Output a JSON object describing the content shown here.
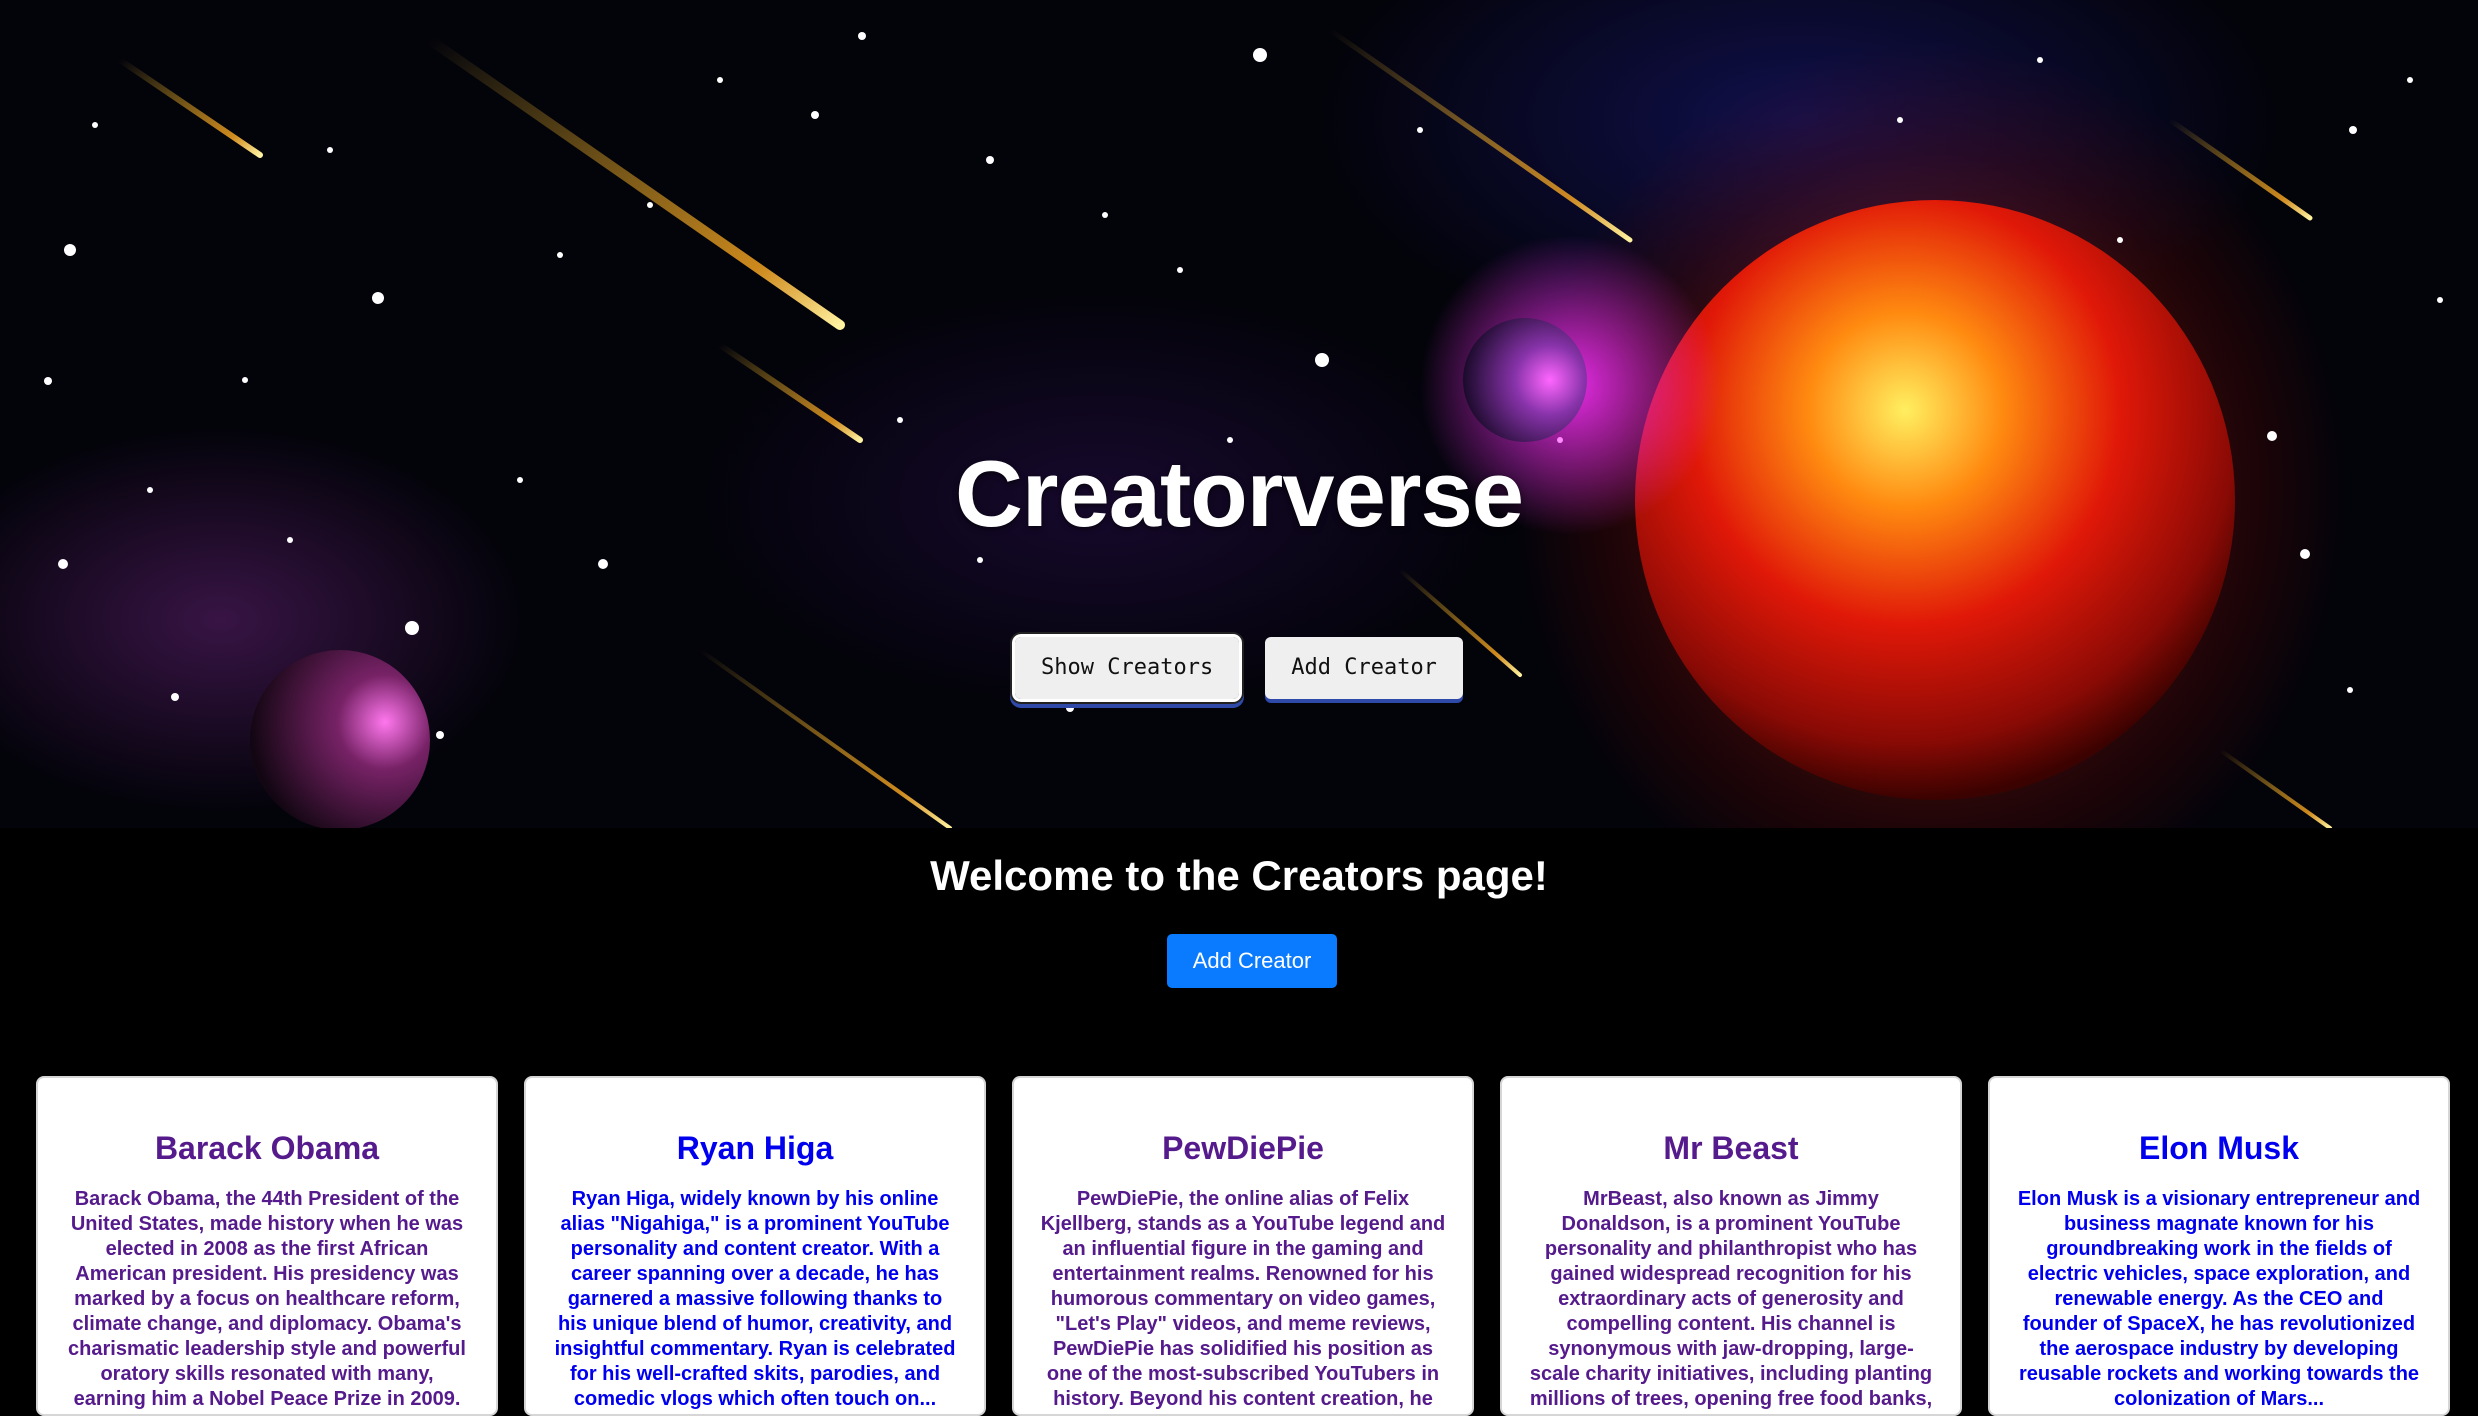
{
  "hero": {
    "title": "Creatorverse",
    "buttons": [
      {
        "label": "Show Creators"
      },
      {
        "label": "Add Creator"
      }
    ]
  },
  "main": {
    "welcome": "Welcome to the Creators page!",
    "add_button": "Add Creator"
  },
  "creators": [
    {
      "name": "Barack Obama",
      "link_color": "#551a8b",
      "description": "Barack Obama, the 44th President of the United States, made history when he was elected in 2008 as the first African American president. His presidency was marked by a focus on healthcare reform, climate change, and diplomacy. Obama's charismatic leadership style and powerful oratory skills resonated with many, earning him a Nobel Peace Prize in 2009."
    },
    {
      "name": "Ryan Higa",
      "link_color": "#0000ee",
      "description": "Ryan Higa, widely known by his online alias \"Nigahiga,\" is a prominent YouTube personality and content creator. With a career spanning over a decade, he has garnered a massive following thanks to his unique blend of humor, creativity, and insightful commentary. Ryan is celebrated for his well-crafted skits, parodies, and comedic vlogs which often touch on..."
    },
    {
      "name": "PewDiePie",
      "link_color": "#551a8b",
      "description": "PewDiePie, the online alias of Felix Kjellberg, stands as a YouTube legend and an influential figure in the gaming and entertainment realms. Renowned for his humorous commentary on video games, \"Let's Play\" videos, and meme reviews, PewDiePie has solidified his position as one of the most-subscribed YouTubers in history. Beyond his content creation, he is..."
    },
    {
      "name": "Mr Beast",
      "link_color": "#551a8b",
      "description": "MrBeast, also known as Jimmy Donaldson, is a prominent YouTube personality and philanthropist who has gained widespread recognition for his extraordinary acts of generosity and compelling content. His channel is synonymous with jaw-dropping, large-scale charity initiatives, including planting millions of trees, opening free food banks, and providing high-stakes..."
    },
    {
      "name": "Elon Musk",
      "link_color": "#0000ee",
      "description": "Elon Musk is a visionary entrepreneur and business magnate known for his groundbreaking work in the fields of electric vehicles, space exploration, and renewable energy. As the CEO and founder of SpaceX, he has revolutionized the aerospace industry by developing reusable rockets and working towards the colonization of Mars..."
    }
  ]
}
